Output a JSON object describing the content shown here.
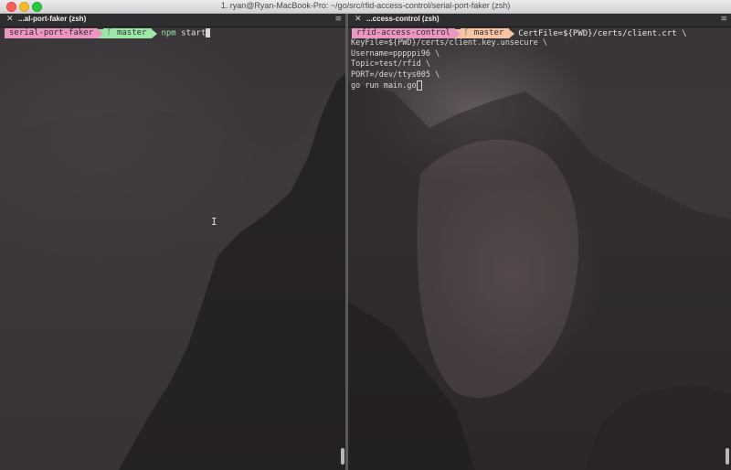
{
  "window": {
    "title": "1. ryan@Ryan-MacBook-Pro: ~/go/src/rfid-access-control/serial-port-faker (zsh)"
  },
  "left_pane": {
    "tab_close": "✕",
    "tab_title": "...al-port-faker (zsh)",
    "tab_menu": "≡",
    "prompt_dir": "serial-port-faker",
    "prompt_branch": "ᚴ master",
    "command_name": "npm",
    "command_args": " start"
  },
  "right_pane": {
    "tab_close": "✕",
    "tab_title": "...ccess-control (zsh)",
    "tab_menu": "≡",
    "prompt_dir": "rfid-access-control",
    "prompt_branch": "ᚴ master",
    "lines": [
      "CertFile=${PWD}/certs/client.crt \\",
      "KeyFile=${PWD}/certs/client.key.unsecure \\",
      "Username=pppppi96 \\",
      "Topic=test/rfid \\",
      "PORT=/dev/ttys005 \\",
      "go run main.go"
    ]
  },
  "colors": {
    "dir_segment": "#ea98c1",
    "git_segment_left": "#9be7a7",
    "git_segment_right": "#f6c5a5"
  }
}
